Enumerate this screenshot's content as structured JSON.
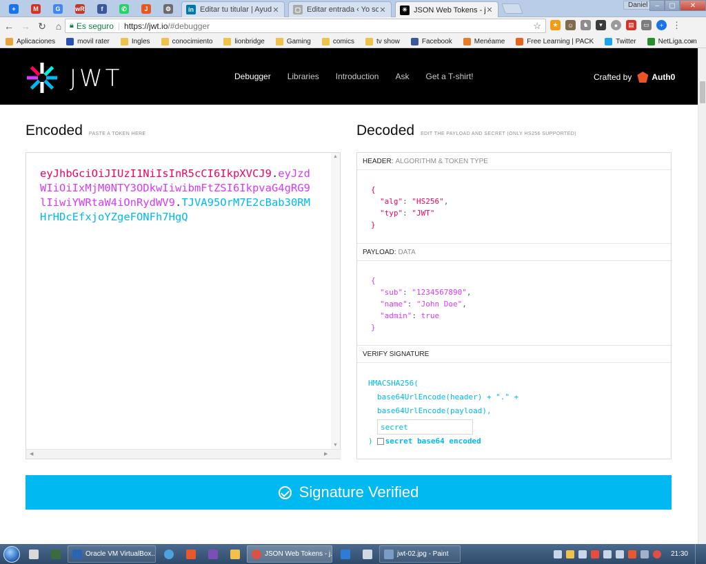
{
  "browser": {
    "pinned_tabs": [
      {
        "icon": "chrome-add-icon",
        "color": "#1a73e8",
        "glyph": "+"
      },
      {
        "icon": "gmail-icon",
        "color": "#d93025",
        "glyph": "M"
      },
      {
        "icon": "translate-icon",
        "color": "#4285f4",
        "glyph": "G"
      },
      {
        "icon": "wordreference-icon",
        "color": "#c0392b",
        "glyph": "wR"
      },
      {
        "icon": "facebook-icon",
        "color": "#3b5998",
        "glyph": "f"
      },
      {
        "icon": "whatsapp-icon",
        "color": "#25d366",
        "glyph": "✆"
      },
      {
        "icon": "orange-app-icon",
        "color": "#e8571e",
        "glyph": "J"
      },
      {
        "icon": "extension-icon",
        "color": "#6b6b6b",
        "glyph": "⚙"
      }
    ],
    "tabs": [
      {
        "title": "Editar tu titular | Ayuda d",
        "favicon_color": "#0077b5",
        "favicon_glyph": "in",
        "active": false
      },
      {
        "title": "Editar entrada ‹ Yo soy D",
        "favicon_color": "#999999",
        "favicon_glyph": "▢",
        "active": false
      },
      {
        "title": "JSON Web Tokens - jwt.io",
        "favicon_color": "#000000",
        "favicon_glyph": "✳",
        "active": true
      }
    ],
    "window_user": "Daniel",
    "window_controls": [
      "–",
      "▢",
      "✕"
    ],
    "address": {
      "secure_label": "Es seguro",
      "url_protocol": "https://",
      "url_host": "jwt.io",
      "url_path": "/#debugger"
    },
    "bookmarks": [
      {
        "label": "Aplicaciones",
        "icon": "apps-grid-icon",
        "color": "#e8a33d"
      },
      {
        "label": "movil rater",
        "icon": "site-icon",
        "color": "#2b4fb3"
      },
      {
        "label": "Ingles",
        "icon": "folder-icon",
        "color": "#f0c24b"
      },
      {
        "label": "conocimiento",
        "icon": "folder-icon",
        "color": "#f0c24b"
      },
      {
        "label": "lionbridge",
        "icon": "folder-icon",
        "color": "#f0c24b"
      },
      {
        "label": "Gaming",
        "icon": "folder-icon",
        "color": "#f0c24b"
      },
      {
        "label": "comics",
        "icon": "folder-icon",
        "color": "#f0c24b"
      },
      {
        "label": "tv show",
        "icon": "folder-icon",
        "color": "#f0c24b"
      },
      {
        "label": "Facebook",
        "icon": "facebook-icon",
        "color": "#3b5998"
      },
      {
        "label": "Menéame",
        "icon": "meneame-icon",
        "color": "#e37d2a"
      },
      {
        "label": "Free Learning | PACK",
        "icon": "packt-icon",
        "color": "#e6621f"
      },
      {
        "label": "Twitter",
        "icon": "twitter-icon",
        "color": "#1da1f2"
      },
      {
        "label": "NetLiga.com",
        "icon": "netliga-icon",
        "color": "#2a8c2a"
      }
    ],
    "bookmarks_more": "»"
  },
  "site": {
    "logo_text": "JWT",
    "menu": [
      {
        "label": "Debugger",
        "active": true
      },
      {
        "label": "Libraries",
        "active": false
      },
      {
        "label": "Introduction",
        "active": false
      },
      {
        "label": "Ask",
        "active": false
      },
      {
        "label": "Get a T-shirt!",
        "active": false
      }
    ],
    "crafted_by": "Crafted by",
    "auth0": "Auth0"
  },
  "encoded": {
    "title": "Encoded",
    "hint": "PASTE A TOKEN HERE",
    "token_header": "eyJhbGciOiJIUzI1NiIsInR5cCI6IkpXVCJ9",
    "token_payload": "eyJzdWIiOiIxMjM0NTY3ODkwIiwibmFtZSI6IkpvaG4gRG9lIiwiYWRtaW4iOnRydWV9",
    "token_signature": "TJVA95OrM7E2cBab30RMHrHDcEfxjoYZgeFONFh7HgQ",
    "dot": "."
  },
  "decoded": {
    "title": "Decoded",
    "hint": "EDIT THE PAYLOAD AND SECRET (ONLY HS256 SUPPORTED)",
    "header": {
      "label": "HEADER:",
      "sub": "ALGORITHM & TOKEN TYPE",
      "alg_key": "\"alg\"",
      "alg_val": "\"HS256\"",
      "typ_key": "\"typ\"",
      "typ_val": "\"JWT\""
    },
    "payload": {
      "label": "PAYLOAD:",
      "sub": "DATA",
      "sub_key": "\"sub\"",
      "sub_val": "\"1234567890\"",
      "name_key": "\"name\"",
      "name_val": "\"John Doe\"",
      "admin_key": "\"admin\"",
      "admin_val": "true"
    },
    "signature": {
      "label": "VERIFY SIGNATURE",
      "line1": "HMACSHA256(",
      "line2": "base64UrlEncode(header) + \".\" +",
      "line3": "base64UrlEncode(payload),",
      "secret_value": "secret",
      "close": ")",
      "b64_label": "secret base64 encoded",
      "b64_checked": false
    }
  },
  "status": {
    "label": "Signature Verified",
    "color": "#00b9f1"
  },
  "taskbar": {
    "items": [
      {
        "label": "Oracle VM VirtualBox...",
        "color": "#2a64b4",
        "active": false
      },
      {
        "label": "JSON Web Tokens - j...",
        "color": "#dd5144",
        "active": true
      },
      {
        "label": "jwt-02.jpg - Paint",
        "color": "#7a9cc6",
        "active": false
      }
    ],
    "clock": "21:30"
  }
}
